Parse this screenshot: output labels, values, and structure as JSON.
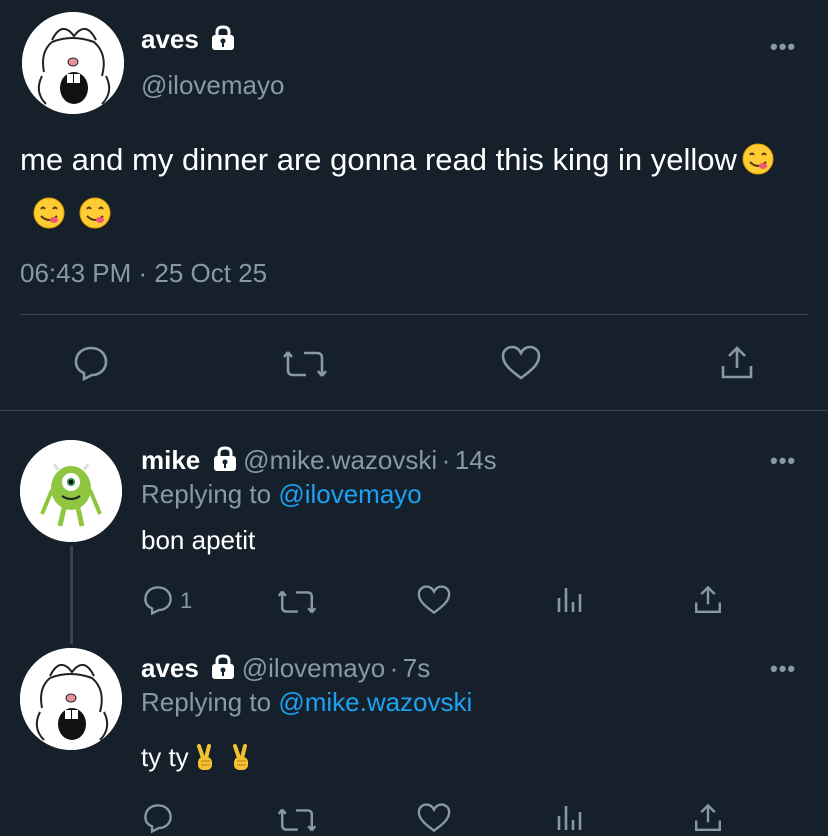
{
  "main_tweet": {
    "name": "aves",
    "handle": "@ilovemayo",
    "text": "me and my dinner are gonna read this king in yellow",
    "emojis": [
      "smiling-face-savoring-food",
      "smiling-face-savoring-food",
      "smiling-face-savoring-food"
    ],
    "timestamp": "06:43 PM · 25 Oct 25"
  },
  "replies": [
    {
      "name": "mike",
      "handle": "@mike.wazovski",
      "time": "14s",
      "replying_prefix": "Replying to ",
      "replying_to": "@ilovemayo",
      "text": "bon apetit",
      "reply_count": "1"
    },
    {
      "name": "aves",
      "handle": "@ilovemayo",
      "time": "7s",
      "replying_prefix": "Replying to ",
      "replying_to": "@mike.wazovski",
      "text": "ty ty",
      "emojis": [
        "victory-hand",
        "victory-hand"
      ]
    }
  ],
  "separator": "·",
  "more_label": "•••",
  "colors": {
    "background": "#15202b",
    "secondary_text": "#8899a6",
    "link": "#1da1f2",
    "divider": "#38444d"
  }
}
